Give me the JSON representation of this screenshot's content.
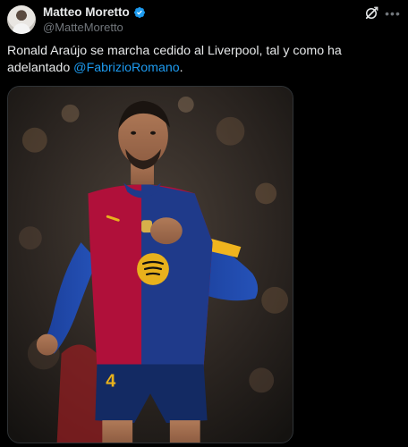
{
  "author": {
    "display_name": "Matteo Moretto",
    "handle": "@MatteMoretto",
    "verified": true
  },
  "tweet": {
    "text_before": "Ronald Araújo se marcha cedido al Liverpool, tal y como ha adelantado ",
    "mention": "@FabrizioRomano",
    "text_after": "."
  },
  "media": {
    "description_icon": "photo",
    "shirt_number": "4"
  },
  "icons": {
    "verified": "verified-badge-icon",
    "grok": "grok-icon",
    "more": "more-options-icon"
  },
  "colors": {
    "background": "#000000",
    "text": "#e7e9ea",
    "secondary": "#71767b",
    "link": "#1d9bf0",
    "verified": "#1d9bf0",
    "barca_blue": "#1f3a8a",
    "barca_red": "#b0103a"
  }
}
